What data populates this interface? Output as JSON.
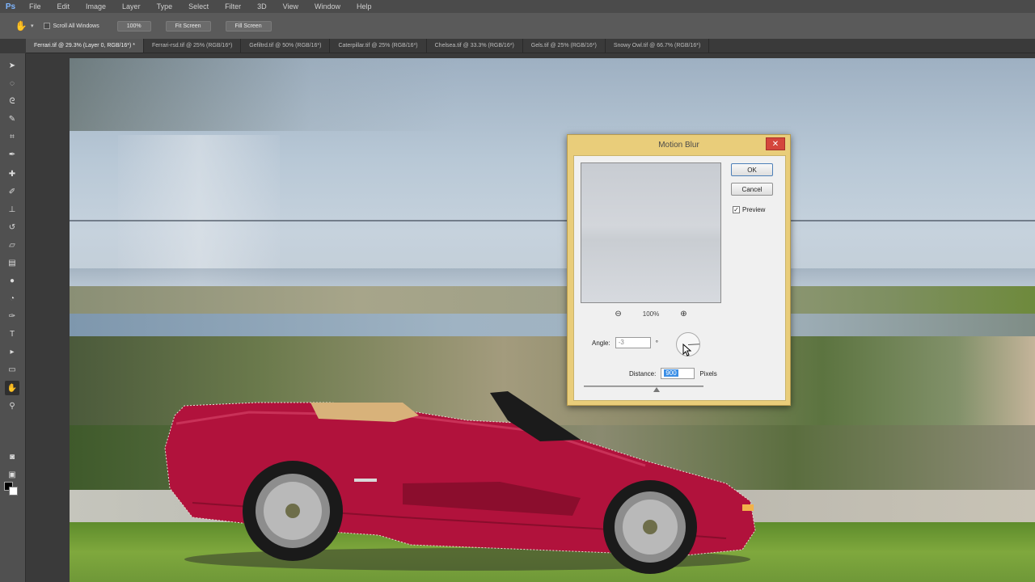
{
  "app": {
    "logo": "Ps"
  },
  "menu": [
    "File",
    "Edit",
    "Image",
    "Layer",
    "Type",
    "Select",
    "Filter",
    "3D",
    "View",
    "Window",
    "Help"
  ],
  "options": {
    "scroll_all_label": "Scroll All Windows",
    "btn_100": "100%",
    "btn_fit": "Fit Screen",
    "btn_fill": "Fill Screen"
  },
  "tabs": [
    "Ferrari.tif @ 29.3% (Layer 0, RGB/16*) *",
    "Ferrari-rsd.tif @ 25% (RGB/16*)",
    "Gefiltrd.tif @ 50% (RGB/16*)",
    "Caterpillar.tif @ 25% (RGB/16*)",
    "Chelsea.tif @ 33.3% (RGB/16*)",
    "Gels.tif @ 25% (RGB/16*)",
    "Snowy Owl.tif @ 66.7% (RGB/16*)"
  ],
  "dialog": {
    "title": "Motion Blur",
    "close": "✕",
    "ok": "OK",
    "cancel": "Cancel",
    "preview_label": "Preview",
    "preview_checked": true,
    "zoom": "100%",
    "angle_label": "Angle:",
    "angle_value": "-3",
    "angle_unit": "°",
    "distance_label": "Distance:",
    "distance_value": "900",
    "distance_unit": "Pixels"
  },
  "colors": {
    "car": "#b1123c",
    "dialog_frame": "#e9cd7a",
    "close": "#d4463c"
  }
}
